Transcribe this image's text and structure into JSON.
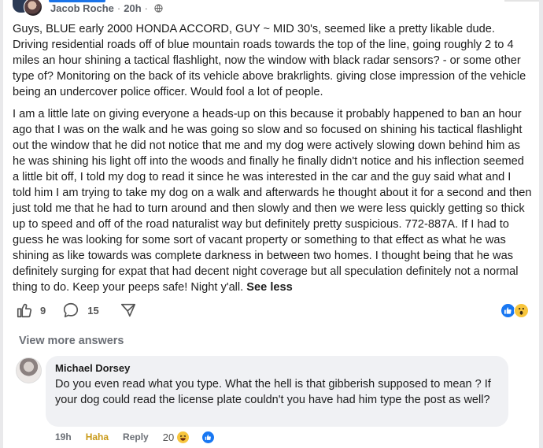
{
  "post": {
    "author": "Jacob Roche",
    "separator": "·",
    "time": "20h",
    "paragraphs": [
      "Guys, BLUE early 2000 HONDA ACCORD, GUY ~ MID 30's, seemed like a pretty likable dude. Driving residential roads off of blue mountain roads towards the top of the line, going roughly 2 to 4 miles an hour shining a tactical flashlight, now the window with black radar sensors? - or some other type of? Monitoring on the back of its vehicle above brakrlights. giving close impression of the vehicle being an undercover police officer. Would fool a lot of people.",
      "I am a little late on giving everyone a heads-up on this because it probably happened to ban an hour ago that I was on the walk and he was going so slow and so focused on shining his tactical flashlight out the window that he did not notice that me and my dog were actively slowing down behind him as he was shining his light off into the woods and finally he finally didn't notice and his inflection seemed a little bit off, I told my dog to read it since he was interested in the car and the guy said what and I told him I am trying to take my dog on a walk and afterwards he thought about it for a second and then just told me that he had to turn around and then slowly and then we were less quickly getting so thick up to speed and off of the road naturalist way but definitely pretty suspicious. 772-887A. If I had to guess he was looking for some sort of vacant property or something to that effect as what he was shining as like towards was complete darkness in between two homes. I thought being that he was definitely surging for expat that had decent night coverage but all speculation definitely not a normal thing to do. Keep your peeps safe! Night y'all."
    ],
    "see_less": "See less",
    "likes": "9",
    "comments": "15"
  },
  "view_more": "View more answers",
  "comment": {
    "name": "Michael Dorsey",
    "text": "Do you even read what you type. What the hell is that gibberish supposed to mean ? If your dog could read the license plate couldn't you have had him type the post as well?",
    "time": "19h",
    "reaction_label": "Haha",
    "reply_label": "Reply",
    "reaction_count": "20"
  },
  "colors": {
    "accent": "#1a73e8",
    "haha": "#c99a18",
    "like": "#1877f2"
  }
}
